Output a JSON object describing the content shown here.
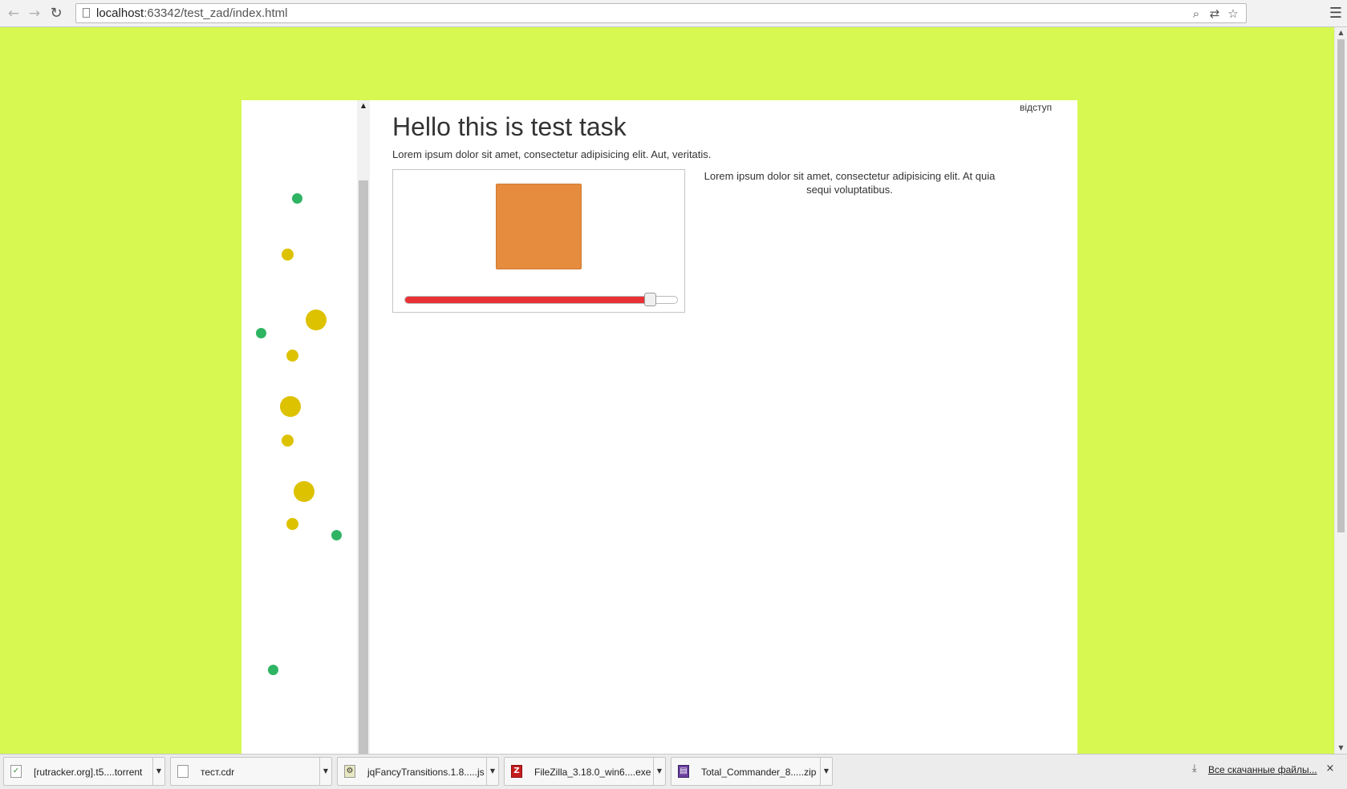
{
  "browser": {
    "url_host": "localhost",
    "url_rest": ":63342/test_zad/index.html",
    "icons": {
      "back": "←",
      "forward": "→",
      "reload": "↻",
      "zoom": "⌕",
      "translate": "⇄",
      "bookmark": "☆",
      "menu": "☰"
    }
  },
  "page": {
    "background_color": "#d6f850",
    "indent_label": "відступ",
    "title": "Hello this is test task",
    "intro": "Lorem ipsum dolor sit amet, consectetur adipisicing elit. Aut, veritatis.",
    "side_text": "Lorem ipsum dolor sit amet, consectetur adipisicing elit. At quia sequi voluptatibus.",
    "square_color": "#e58c3e",
    "slider": {
      "value_fraction": 0.9,
      "fill_color": "#e83135"
    },
    "dots": [
      {
        "color": "green"
      },
      {
        "color": "yellow"
      },
      {
        "color": "yellow"
      },
      {
        "color": "green"
      },
      {
        "color": "yellow"
      },
      {
        "color": "yellow"
      },
      {
        "color": "yellow"
      },
      {
        "color": "yellow"
      },
      {
        "color": "yellow"
      },
      {
        "color": "green"
      },
      {
        "color": "green"
      }
    ]
  },
  "downloads": {
    "items": [
      {
        "name": "[rutracker.org].t5....torrent",
        "icon": "torrent-file-icon"
      },
      {
        "name": "тест.cdr",
        "icon": "document-icon"
      },
      {
        "name": "jqFancyTransitions.1.8.....js",
        "icon": "script-file-icon"
      },
      {
        "name": "FileZilla_3.18.0_win6....exe",
        "icon": "filezilla-icon"
      },
      {
        "name": "Total_Commander_8.....zip",
        "icon": "archive-icon"
      }
    ],
    "show_all": "Все скачанные файлы...",
    "close": "×"
  }
}
